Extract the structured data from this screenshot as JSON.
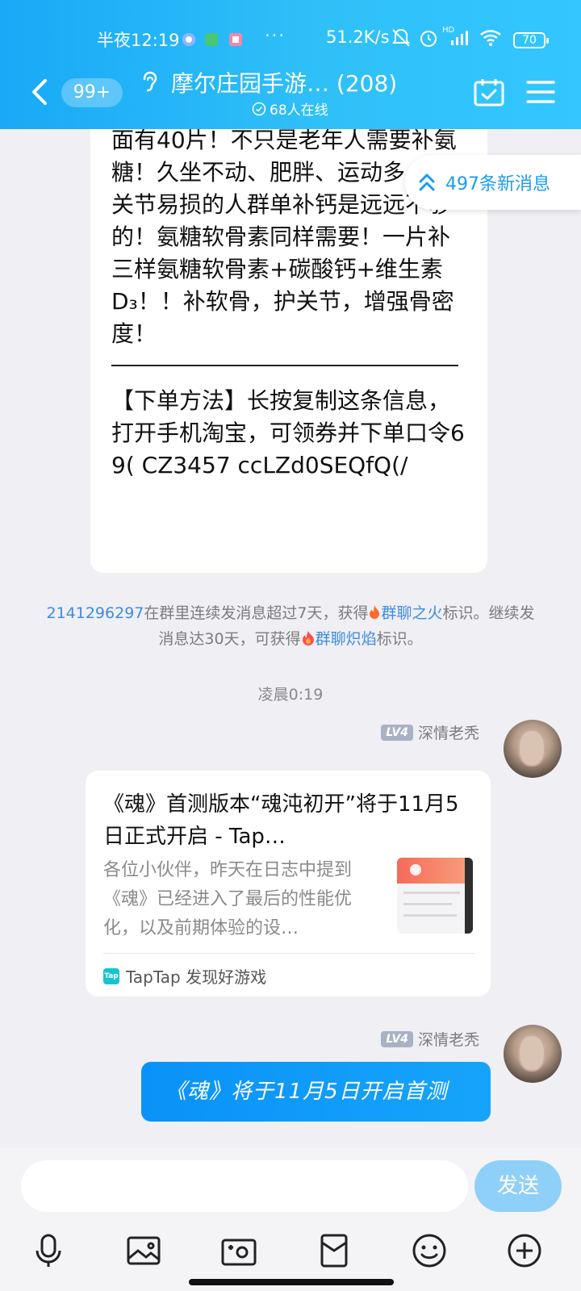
{
  "status_bar": {
    "time": "半夜12:19",
    "more": "···",
    "net_speed": "51.2K/s",
    "battery": "70",
    "net_type": "HD"
  },
  "header": {
    "back_count": "99+",
    "title": "摩尔庄园手游…  (208)",
    "online": "68人在线"
  },
  "new_messages": "497条新消息",
  "long_message": {
    "paragraph1": "面有40片！不只是老年人需要补氨糖！久坐不动、肥胖、运动多、是关节易损的人群单补钙是远远不够的！氨糖软骨素同样需要！一片补三样氨糖软骨素+碳酸钙+维生素D₃！！补软骨，护关节，增强骨密度！",
    "paragraph2": "【下单方法】长按复制这条信息，打开手机淘宝，可领券并下单口令69( CZ3457 ccLZd0SEQfQ(/"
  },
  "system_notice": {
    "uid": "2141296297",
    "text1": "在群里连续发消息超过7天，获得",
    "badge1": "群聊之火",
    "text2": "标识。继续发消息达30天，可获得",
    "badge2": "群聊炽焰",
    "text3": "标识。"
  },
  "time_separator": "凌晨0:19",
  "messages": [
    {
      "sender_level": "LV4",
      "sender_name": "深情老秃",
      "card": {
        "title": "《魂》首测版本“魂沌初开”将于11月5日正式开启 - Tap…",
        "description": "各位小伙伴，昨天在日志中提到《魂》已经进入了最后的性能优化，以及前期体验的设…",
        "source_logo": "Tap",
        "source": "TapTap 发现好游戏"
      }
    },
    {
      "sender_level": "LV4",
      "sender_name": "深情老秃",
      "text": "《魂》将于11月5日开启首测"
    }
  ],
  "input": {
    "placeholder": "",
    "send_label": "发送"
  },
  "toolbar": [
    "mic-icon",
    "image-icon",
    "camera-icon",
    "red-packet-icon",
    "emoji-icon",
    "plus-icon"
  ],
  "colors": {
    "header_gradient_start": "#19a9f7",
    "header_gradient_end": "#33c6ff",
    "link_blue": "#3f8ce0",
    "bubble_blue": "#0a92f8",
    "send_button": "#8fd0f8"
  }
}
